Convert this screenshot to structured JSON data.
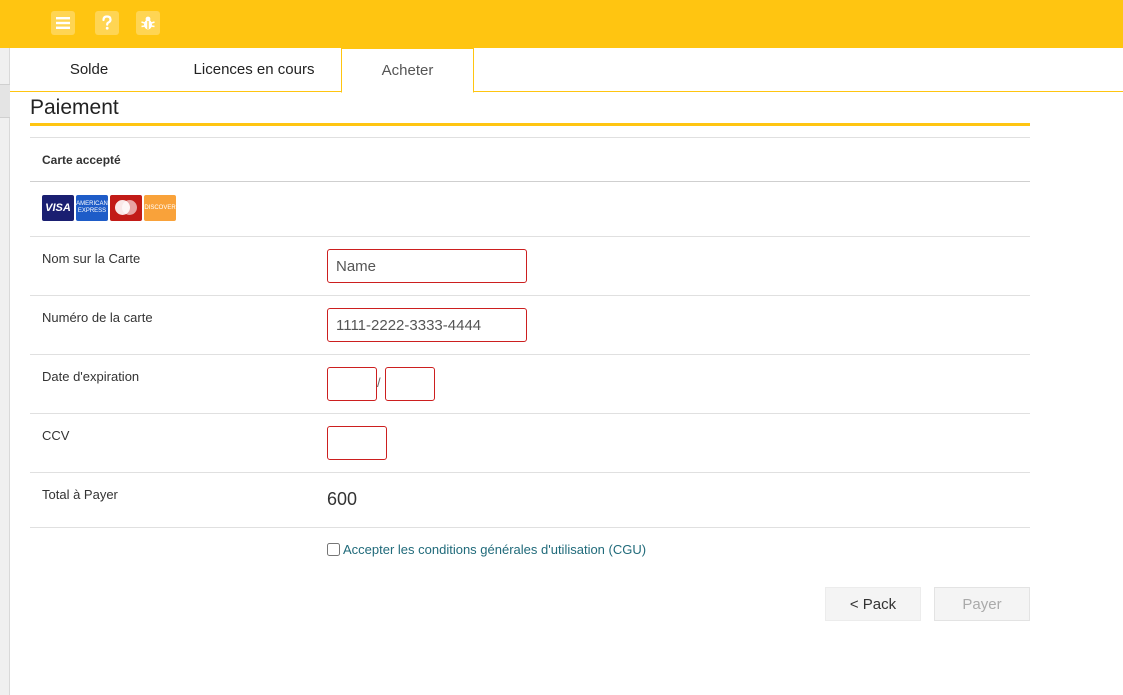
{
  "colors": {
    "accent": "#ffc511",
    "error_border": "#cc1f1f",
    "link": "#206a7a"
  },
  "topbar": {
    "icons": [
      "menu-icon",
      "help-icon",
      "bug-icon"
    ]
  },
  "tabs": [
    {
      "label": "Solde",
      "active": false
    },
    {
      "label": "Licences en cours",
      "active": false
    },
    {
      "label": "Acheter",
      "active": true
    }
  ],
  "page": {
    "title": "Paiement"
  },
  "form": {
    "cards_label": "Carte accepté",
    "cards": [
      {
        "name": "VISA",
        "text": "VISA"
      },
      {
        "name": "American Express",
        "text": "AMERICAN EXPRESS"
      },
      {
        "name": "MasterCard",
        "text": ""
      },
      {
        "name": "Discover",
        "text": "DISCOVER"
      }
    ],
    "name_label": "Nom sur la Carte",
    "name_placeholder": "Name",
    "number_label": "Numéro de la carte",
    "number_placeholder": "1111-2222-3333-4444",
    "expiry_label": "Date d'expiration",
    "expiry_separator": "/",
    "ccv_label": "CCV",
    "total_label": "Total à Payer",
    "total_value": "600",
    "cgu_label": "Accepter les conditions générales d'utilisation (CGU)"
  },
  "actions": {
    "back_label": "< Pack",
    "pay_label": "Payer"
  }
}
